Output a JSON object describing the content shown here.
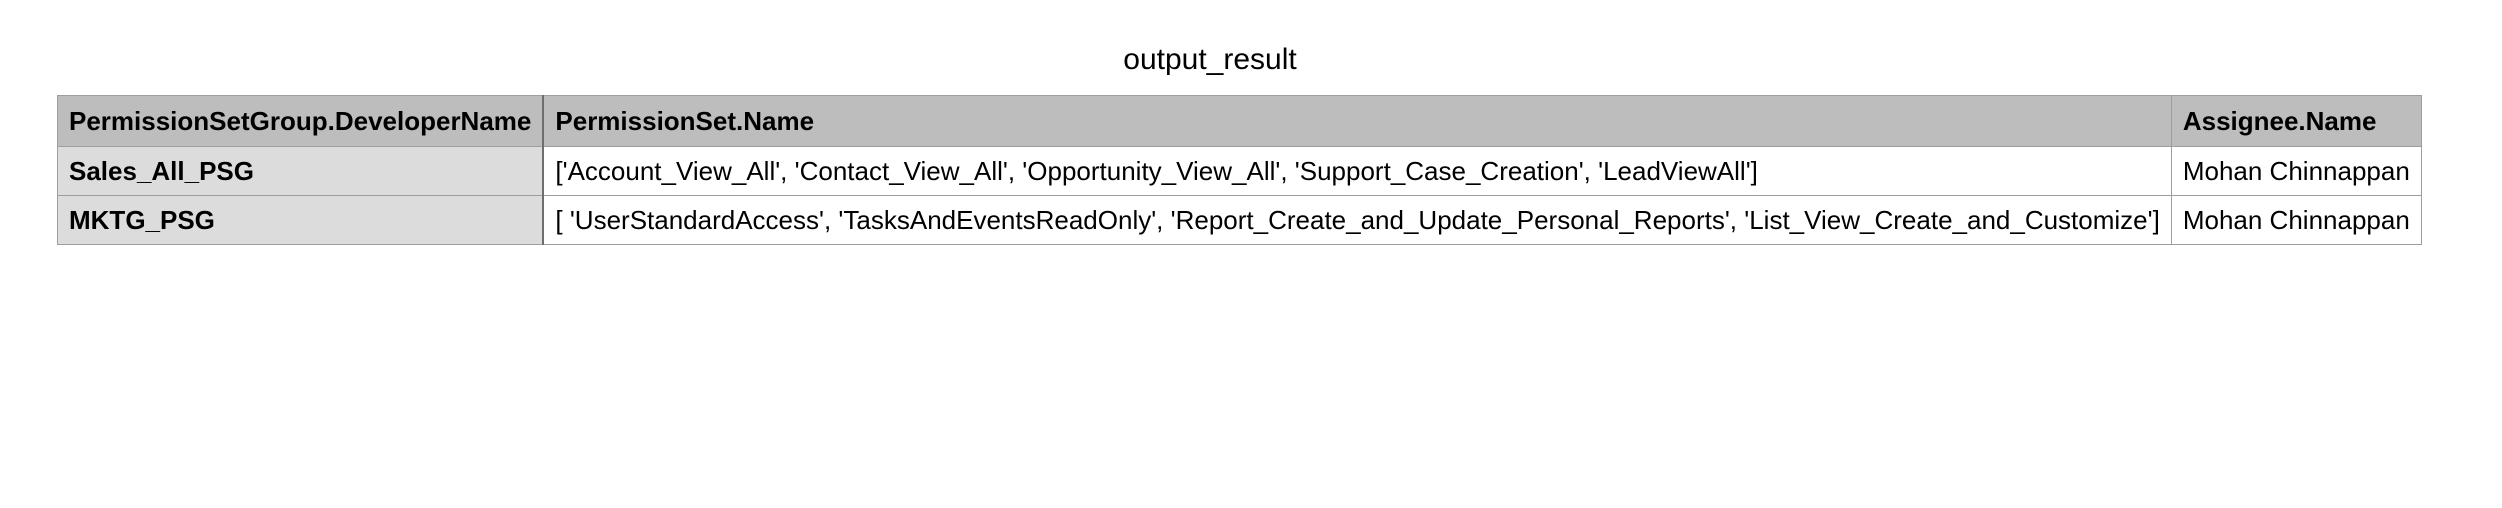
{
  "title": "output_result",
  "table": {
    "columns": [
      "PermissionSetGroup.DeveloperName",
      "PermissionSet.Name",
      "Assignee.Name"
    ],
    "rows": [
      {
        "group": "Sales_All_PSG",
        "permission_sets": "['Account_View_All', 'Contact_View_All', 'Opportunity_View_All', 'Support_Case_Creation', 'LeadViewAll']",
        "assignee": "Mohan Chinnappan"
      },
      {
        "group": "MKTG_PSG",
        "permission_sets": "[ 'UserStandardAccess', 'TasksAndEventsReadOnly', 'Report_Create_and_Update_Personal_Reports', 'List_View_Create_and_Customize']",
        "assignee": "Mohan Chinnappan"
      }
    ]
  }
}
